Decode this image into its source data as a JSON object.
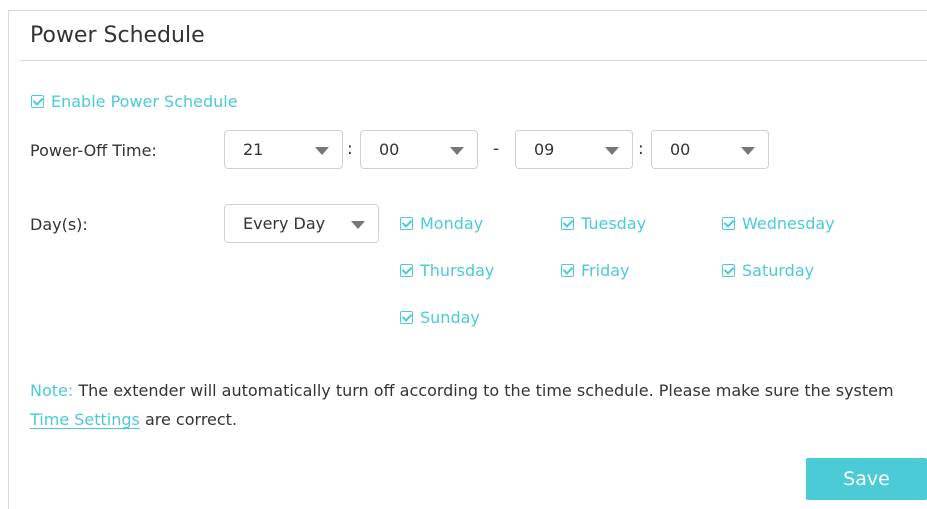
{
  "title": "Power Schedule",
  "enable": {
    "label": "Enable Power Schedule",
    "checked": true
  },
  "power_off": {
    "label": "Power-Off Time:",
    "start_hour": "21",
    "start_minute": "00",
    "range_separator": "-",
    "end_hour": "09",
    "end_minute": "00",
    "time_separator": ":"
  },
  "days": {
    "label": "Day(s):",
    "mode": "Every Day",
    "items": [
      {
        "label": "Monday",
        "checked": true
      },
      {
        "label": "Tuesday",
        "checked": true
      },
      {
        "label": "Wednesday",
        "checked": true
      },
      {
        "label": "Thursday",
        "checked": true
      },
      {
        "label": "Friday",
        "checked": true
      },
      {
        "label": "Saturday",
        "checked": true
      },
      {
        "label": "Sunday",
        "checked": true
      }
    ]
  },
  "note": {
    "prefix": "Note:",
    "text": "The extender will automatically turn off according to the time schedule. Please make sure the system",
    "link": "Time Settings",
    "suffix": "are correct."
  },
  "save_label": "Save",
  "colors": {
    "accent": "#4acbd6",
    "text": "#333333",
    "border": "#d0d0d0"
  }
}
